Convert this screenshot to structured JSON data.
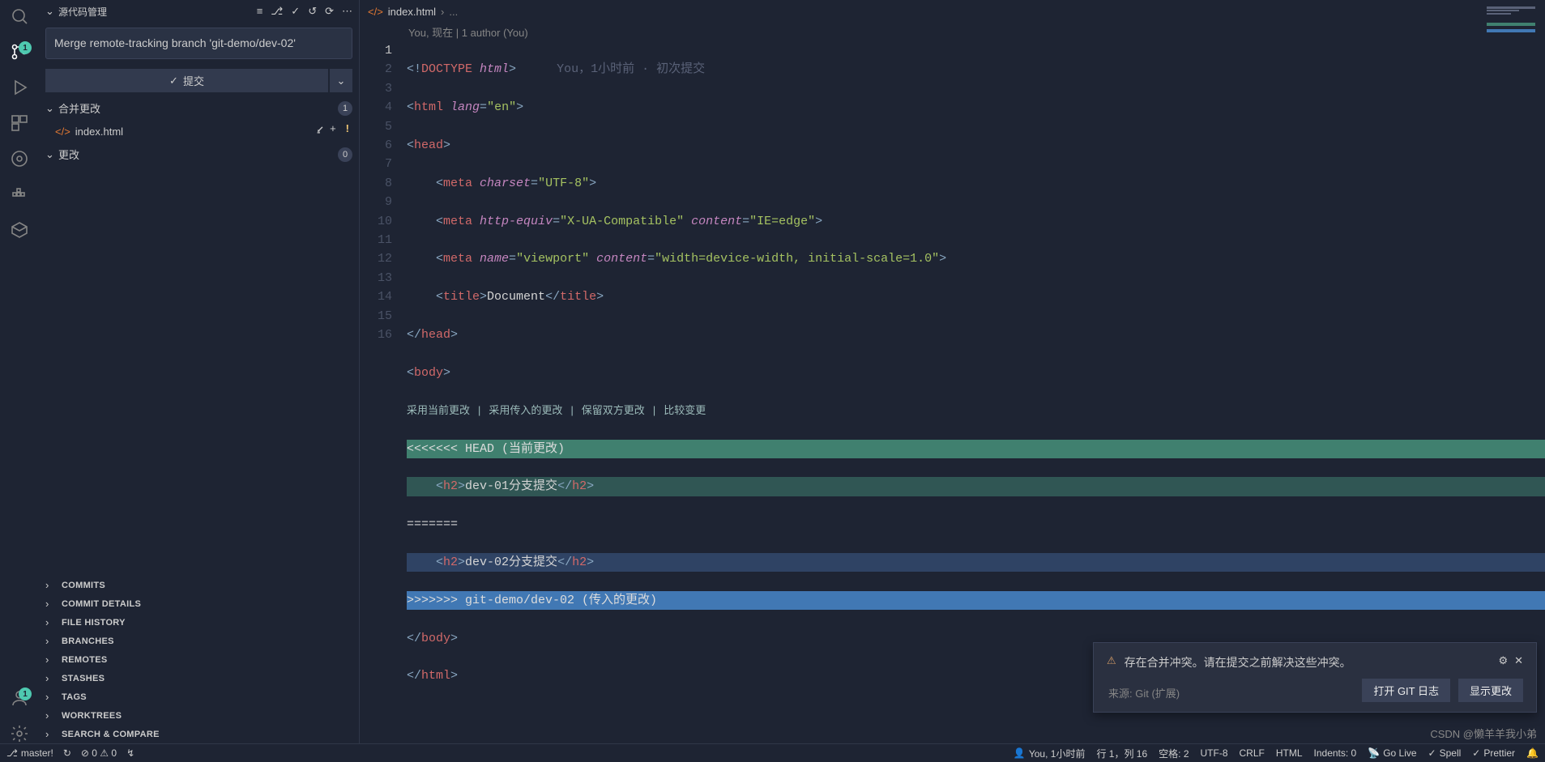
{
  "sidebar": {
    "title": "源代码管理",
    "commit_message": "Merge remote-tracking branch 'git-demo/dev-02'",
    "commit_btn": "提交",
    "merge_section": "合并更改",
    "merge_count": "1",
    "changes_section": "更改",
    "changes_count": "0",
    "file": "index.html",
    "file_status": "!",
    "panels": [
      "COMMITS",
      "COMMIT DETAILS",
      "FILE HISTORY",
      "BRANCHES",
      "REMOTES",
      "STASHES",
      "TAGS",
      "WORKTREES",
      "SEARCH & COMPARE"
    ]
  },
  "activity": {
    "scm_badge": "1",
    "acct_badge": "1"
  },
  "tab": {
    "file": "index.html",
    "crumb": "..."
  },
  "gitlens": {
    "author_line": "You, 现在 | 1 author (You)"
  },
  "editor": {
    "lines": [
      "1",
      "2",
      "3",
      "4",
      "5",
      "6",
      "7",
      "8",
      "9",
      "",
      "10",
      "11",
      "12",
      "13",
      "14",
      "15",
      "16"
    ],
    "inline_blame": "You，1小时前 · 初次提交",
    "conflict_actions": "采用当前更改 | 采用传入的更改 | 保留双方更改 | 比较变更",
    "code": {
      "l1_a": "<!",
      "l1_b": "DOCTYPE",
      "l1_c": " html",
      "l1_d": ">",
      "l2_a": "<",
      "l2_b": "html",
      "l2_c": " lang",
      "l2_d": "=",
      "l2_e": "\"en\"",
      "l2_f": ">",
      "l3_a": "<",
      "l3_b": "head",
      "l3_c": ">",
      "l4_a": "    <",
      "l4_b": "meta",
      "l4_c": " charset",
      "l4_d": "=",
      "l4_e": "\"UTF-8\"",
      "l4_f": ">",
      "l5_a": "    <",
      "l5_b": "meta",
      "l5_c": " http-equiv",
      "l5_d": "=",
      "l5_e": "\"X-UA-Compatible\"",
      "l5_f": " content",
      "l5_g": "=",
      "l5_h": "\"IE=edge\"",
      "l5_i": ">",
      "l6_a": "    <",
      "l6_b": "meta",
      "l6_c": " name",
      "l6_d": "=",
      "l6_e": "\"viewport\"",
      "l6_f": " content",
      "l6_g": "=",
      "l6_h": "\"width=device-width, initial-scale=1.0\"",
      "l6_i": ">",
      "l7_a": "    <",
      "l7_b": "title",
      "l7_c": ">",
      "l7_d": "Document",
      "l7_e": "</",
      "l7_f": "title",
      "l7_g": ">",
      "l8_a": "</",
      "l8_b": "head",
      "l8_c": ">",
      "l9_a": "<",
      "l9_b": "body",
      "l9_c": ">",
      "l10": "<<<<<<< HEAD (当前更改)",
      "l11_a": "    <",
      "l11_b": "h2",
      "l11_c": ">",
      "l11_d": "dev-01分支提交",
      "l11_e": "</",
      "l11_f": "h2",
      "l11_g": ">",
      "l12": "=======",
      "l13_a": "    <",
      "l13_b": "h2",
      "l13_c": ">",
      "l13_d": "dev-02分支提交",
      "l13_e": "</",
      "l13_f": "h2",
      "l13_g": ">",
      "l14": ">>>>>>> git-demo/dev-02 (传入的更改)",
      "l15_a": "</",
      "l15_b": "body",
      "l15_c": ">",
      "l16_a": "</",
      "l16_b": "html",
      "l16_c": ">"
    }
  },
  "toast": {
    "message": "存在合并冲突。请在提交之前解决这些冲突。",
    "source": "来源: Git (扩展)",
    "btn1": "打开 GIT 日志",
    "btn2": "显示更改"
  },
  "status": {
    "branch": "master!",
    "sync": "↻",
    "errors": "⊘ 0 ⚠ 0",
    "port": "↯",
    "blame": "You, 1小时前",
    "pos": "行 1，列 16",
    "spaces": "空格: 2",
    "enc": "UTF-8",
    "eol": "CRLF",
    "lang": "HTML",
    "indents": "Indents: 0",
    "golive": "Go Live",
    "spell": "Spell",
    "prettier": "Prettier"
  },
  "watermark": "CSDN @懒羊羊我小弟"
}
